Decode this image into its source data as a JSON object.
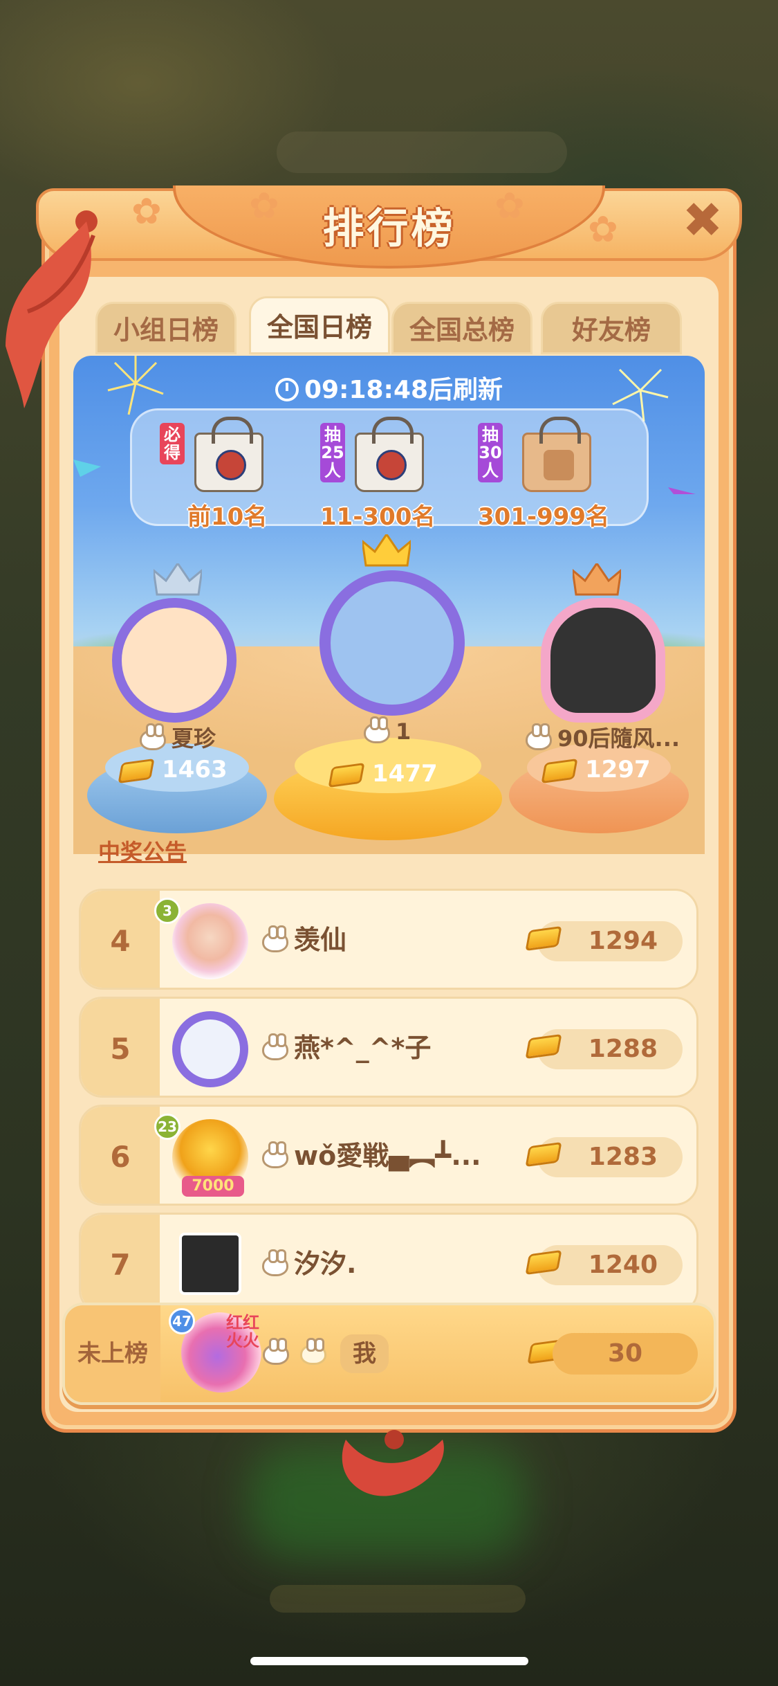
{
  "title": "排行榜",
  "tabs": [
    {
      "label": "小组日榜",
      "active": false
    },
    {
      "label": "全国日榜",
      "active": true
    },
    {
      "label": "全国总榜",
      "active": false
    },
    {
      "label": "好友榜",
      "active": false
    }
  ],
  "refresh_text": "09:18:48后刷新",
  "prizes": [
    {
      "tag": "必得",
      "tag_color": "#e8455a",
      "range": "前10名"
    },
    {
      "tag": "抽25人",
      "tag_color": "#a54ad8",
      "range": "11-300名"
    },
    {
      "tag": "抽30人",
      "tag_color": "#a54ad8",
      "range": "301-999名"
    }
  ],
  "podium": [
    {
      "rank": "2",
      "name": "夏珍",
      "score": "1463"
    },
    {
      "rank": "1",
      "name": "1",
      "score": "1477"
    },
    {
      "rank": "3",
      "name": "90后隨风...",
      "score": "1297"
    }
  ],
  "announcement": "中奖公告",
  "list": [
    {
      "rank": "4",
      "level": "3",
      "name": "羡仙",
      "score": "1294"
    },
    {
      "rank": "5",
      "level": "",
      "name": "燕*^_^*子",
      "score": "1288"
    },
    {
      "rank": "6",
      "level": "23",
      "badge": "7000",
      "name": "wǒ愛戦▄︻┻...",
      "score": "1283"
    },
    {
      "rank": "7",
      "level": "",
      "name": "汐汐.",
      "score": "1240"
    }
  ],
  "me": {
    "rank_label": "未上榜",
    "level": "47",
    "avatar_text": "红红火火",
    "name": "我",
    "score": "30"
  },
  "colors": {
    "accent": "#f7b56e",
    "sky": "#4f8fe6",
    "gold": "#f5a623"
  }
}
